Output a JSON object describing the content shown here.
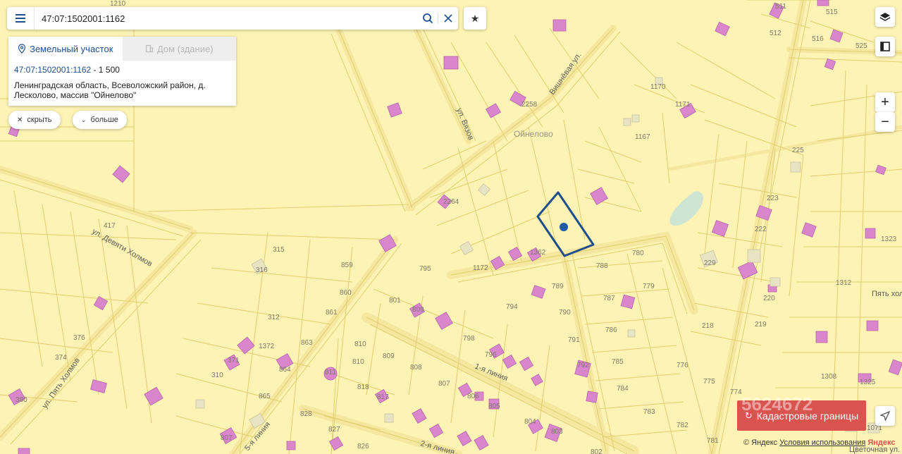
{
  "search": {
    "query": "47:07:1502001:1162"
  },
  "card": {
    "tab_land": "Земельный участок",
    "tab_house": "Дом (здание)",
    "cadastral_number": "47:07:1502001:1162",
    "area_sep": " - ",
    "area": "1 500",
    "address_line1": "Ленинградская область, Всеволожский район, д.",
    "address_line2": "Лесколово, массив \"Ойнелово\""
  },
  "pills": {
    "hide": "скрыть",
    "more": "больше"
  },
  "controls": {
    "zoom_in": "+",
    "zoom_out": "−"
  },
  "cadastral_button": "Кадастровые границы",
  "watermark": "5624672",
  "footer": {
    "copyright": "© Яндекс",
    "terms": "Условия использования",
    "brand": "Яндекс"
  },
  "map": {
    "streets": {
      "vishnevaya": "Вишнёвая ул.",
      "vyazov": "ул. Вязов",
      "devyati_kholmov": "ул. Девяти Холмов",
      "pyat_kholmov": "ул. Пять Холмов",
      "pyat_kholmov_right": "Пять хол",
      "linia1": "1-я линия",
      "linia2": "2-я линия",
      "linia5": "5-я линия",
      "tsvetochnaya": "Цветочная ул."
    },
    "place": "Ойнелово",
    "parcel_numbers": {
      "n1210": "1210",
      "n511": "511",
      "n515": "515",
      "n512": "512",
      "n516": "516",
      "n525": "525",
      "n1170": "1170",
      "n1171": "1171",
      "n2258": "2258",
      "n1167": "1167",
      "n225": "225",
      "n223": "223",
      "n222": "222",
      "n2264": "2264",
      "n417": "417",
      "n315": "315",
      "n316": "316",
      "n859": "859",
      "n795": "795",
      "n1172": "1172",
      "n1362": "1362",
      "n780": "780",
      "n788": "788",
      "n229": "229",
      "n1323": "1323",
      "n1312": "1312",
      "n860": "860",
      "n801": "801",
      "n789": "789",
      "n779": "779",
      "n787": "787",
      "n220": "220",
      "n218": "218",
      "n219": "219",
      "n312": "312",
      "n861": "861",
      "n809r": "809",
      "n794": "794",
      "n790": "790",
      "n786": "786",
      "n376": "376",
      "n863": "863",
      "n798": "798",
      "n791": "791",
      "n1372": "1372",
      "n810": "810",
      "n809": "809",
      "n785": "785",
      "n776": "776",
      "n374": "374",
      "n371": "371",
      "n864": "864",
      "n810b": "810",
      "n808": "808",
      "n796": "796",
      "n792": "792",
      "n1308": "1308",
      "n310": "310",
      "n818": "818",
      "n807": "807",
      "n784": "784",
      "n775": "775",
      "n774": "774",
      "n380": "380",
      "n865": "865",
      "n817": "817",
      "n806": "806",
      "n805": "805",
      "n783": "783",
      "n828": "828",
      "n804": "804",
      "n782": "782",
      "n827": "827",
      "n803": "803",
      "n826": "826",
      "n781": "781",
      "n1071": "1071",
      "n802": "802",
      "n807b": "807",
      "n811": "811",
      "n1325": "1325"
    }
  }
}
